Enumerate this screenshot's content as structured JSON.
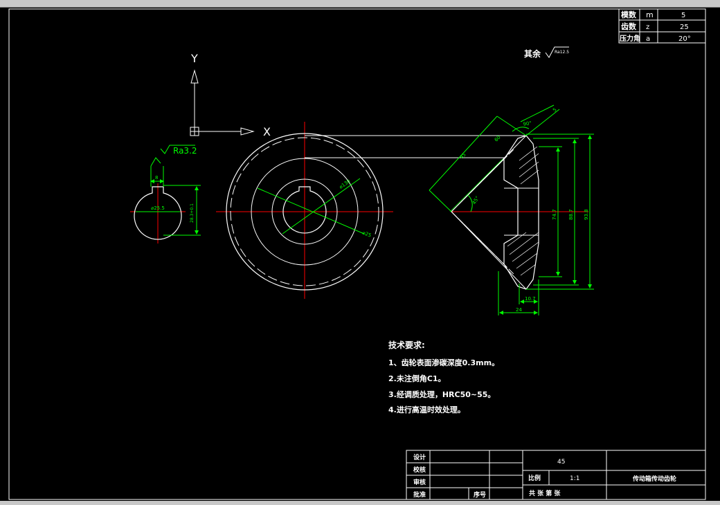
{
  "param_table": {
    "rows": [
      {
        "name": "模数",
        "symbol": "m",
        "value": "5"
      },
      {
        "name": "齿数",
        "symbol": "z",
        "value": "25"
      },
      {
        "name": "压力角",
        "symbol": "a",
        "value": "20°"
      }
    ]
  },
  "surface_note": {
    "prefix": "其余",
    "roughness": "Ra12.5"
  },
  "ucs": {
    "y_label": "Y",
    "x_label": "X"
  },
  "keyway_view": {
    "roughness": "Ra3.2",
    "width_dim": "8",
    "diameter_dim": "⌀25.5",
    "height_dim": "28.3+0.1"
  },
  "gear_front": {
    "outer_dim": "⌀130",
    "inner_dim": "⌀25"
  },
  "gear_section": {
    "angle_top": "90°",
    "slant_a": "5",
    "slant_b": "60",
    "slant_c": "45",
    "half_angle": "45°",
    "dia_1": "74.7",
    "dia_2": "88.7",
    "dia_3": "93.8",
    "bottom_1": "10.7",
    "bottom_2": "24"
  },
  "tech_requirements": {
    "title": "技术要求:",
    "items": [
      "1、齿轮表面渗碳深度0.3mm。",
      "2.未注倒角C1。",
      "3.经调质处理，HRC50~55。",
      "4.进行高温时效处理。"
    ]
  },
  "title_block": {
    "labels": [
      "设计",
      "校核",
      "审核",
      "批准"
    ],
    "seq_label": "序号",
    "material": "45",
    "scale_label": "比例",
    "scale_value": "1:1",
    "sheet_text": "共  张  第  张",
    "drawing_name": "传动箱传动齿轮"
  },
  "colors": {
    "background": "#000000",
    "outline": "#ffffff",
    "dimension": "#00ff00",
    "centerline": "#ff0000"
  }
}
